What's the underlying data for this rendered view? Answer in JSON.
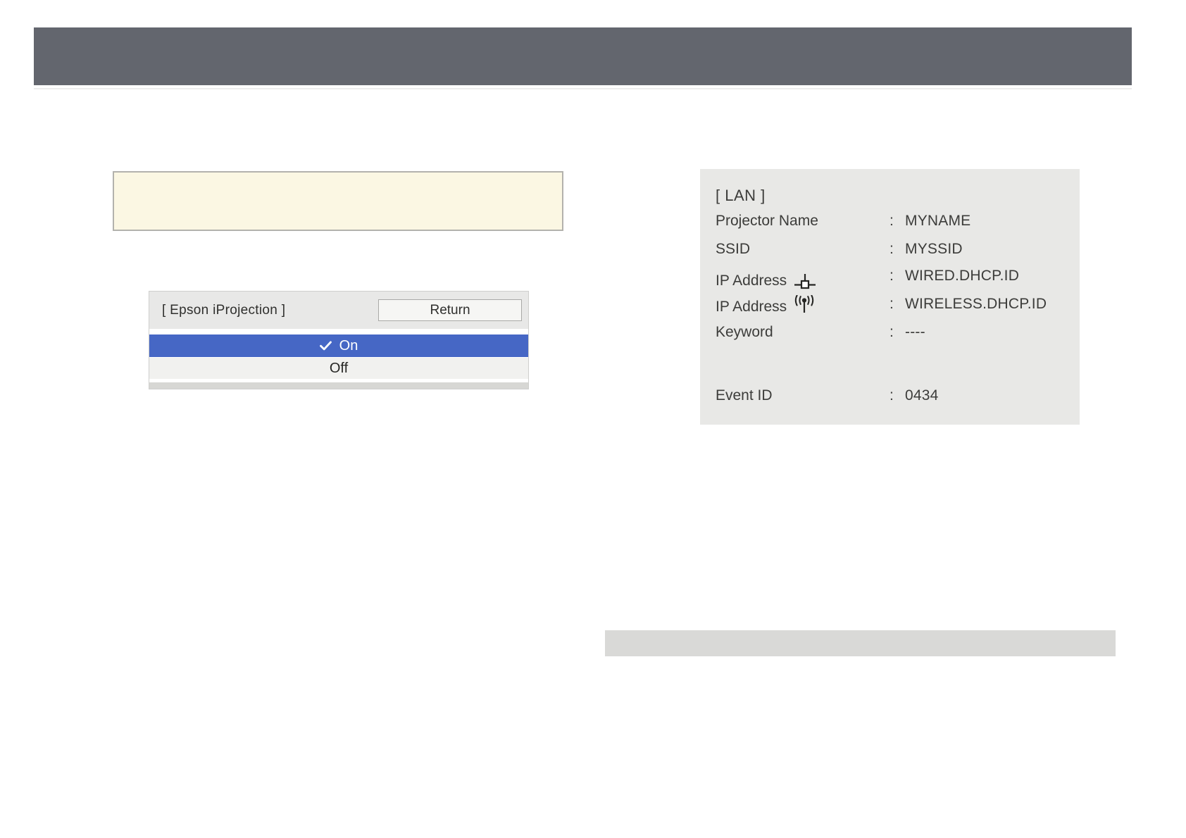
{
  "iprojection_menu": {
    "title": "[ Epson iProjection ]",
    "return_label": "Return",
    "options": [
      {
        "label": "On",
        "selected": true
      },
      {
        "label": "Off",
        "selected": false
      }
    ]
  },
  "lan_panel": {
    "title": "[ LAN ]",
    "colon": ":",
    "rows": [
      {
        "label": "Projector Name",
        "icon": "",
        "value": "MYNAME"
      },
      {
        "label": "SSID",
        "icon": "",
        "value": "MYSSID"
      },
      {
        "label": "IP Address",
        "icon": "wired-network-icon",
        "value": "WIRED.DHCP.ID"
      },
      {
        "label": "IP Address",
        "icon": "wireless-network-icon",
        "value": "WIRELESS.DHCP.ID"
      },
      {
        "label": "Keyword",
        "icon": "",
        "value": "----"
      }
    ],
    "event_row": {
      "label": "Event ID",
      "value": "0434"
    }
  },
  "colors": {
    "top_bar": "#63666e",
    "note_box_bg": "#fbf7e3",
    "note_box_border": "#b3b2ad",
    "menu_header": "#e8e8e7",
    "selected_row": "#4667c5",
    "panel_bg": "#e8e8e6",
    "bottom_bar": "#d9d9d7"
  }
}
